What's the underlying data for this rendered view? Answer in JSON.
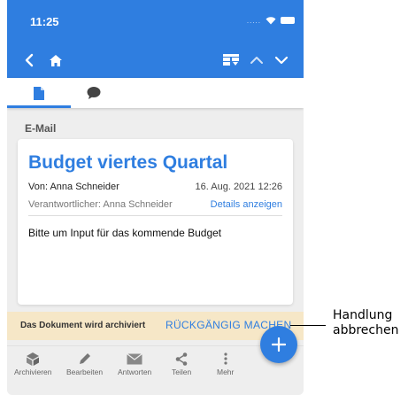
{
  "status_bar": {
    "time": "11:25",
    "signal": "....."
  },
  "tabs": [
    {
      "icon": "document-icon",
      "active": true
    },
    {
      "icon": "comment-icon",
      "active": false
    }
  ],
  "section_label": "E-Mail",
  "email": {
    "title": "Budget viertes Quartal",
    "from": "Von: Anna Schneider",
    "date": "16. Aug. 2021 12:26",
    "responsible": "Verantwortlicher: Anna Schneider",
    "details_link": "Details anzeigen",
    "body": "Bitte um Input für das kommende Budget"
  },
  "snackbar": {
    "message": "Das Dokument wird archiviert",
    "action": "RÜCKGÄNGIG MACHEN"
  },
  "bottom_actions": [
    {
      "label": "Archivieren",
      "icon": "archive-icon"
    },
    {
      "label": "Bearbeiten",
      "icon": "pencil-icon"
    },
    {
      "label": "Antworten",
      "icon": "reply-mail-icon"
    },
    {
      "label": "Teilen",
      "icon": "share-icon"
    },
    {
      "label": "Mehr",
      "icon": "more-vertical-icon"
    }
  ],
  "fab": {
    "icon": "plus-icon"
  },
  "callout": {
    "line1": "Handlung",
    "line2": "abbrechen"
  },
  "colors": {
    "primary": "#2f7ee0",
    "snackbar_bg": "#f6e7c7",
    "background": "#eeeeee"
  }
}
